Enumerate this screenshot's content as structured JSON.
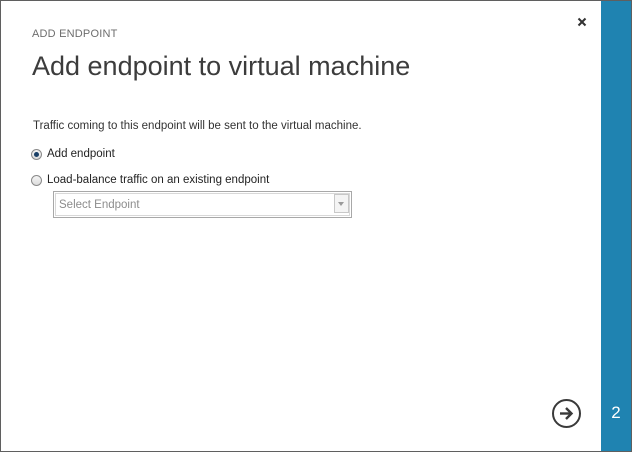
{
  "dialog": {
    "subtitle": "ADD ENDPOINT",
    "title": "Add endpoint to virtual machine",
    "description": "Traffic coming to this endpoint will be sent to the virtual machine."
  },
  "options": [
    {
      "label": "Add endpoint",
      "checked": true
    },
    {
      "label": "Load-balance traffic on an existing endpoint",
      "checked": false
    }
  ],
  "endpoint_select": {
    "placeholder": "Select Endpoint"
  },
  "step": {
    "number": "2"
  },
  "icons": {
    "close": "close-icon",
    "next": "arrow-right-circle-icon",
    "dropdown": "chevron-down-icon"
  },
  "colors": {
    "accent": "#1f83b1",
    "title": "#3c3c3c",
    "subtitle": "#6d6d6d"
  }
}
